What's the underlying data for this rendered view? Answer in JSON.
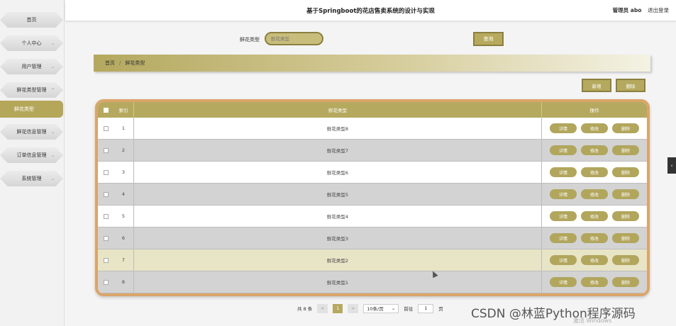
{
  "app": {
    "title": "基于Springboot的花店售卖系统的设计与实现",
    "user": "管理员 abo",
    "logout": "退出登录"
  },
  "sidebar": {
    "items": [
      {
        "label": "首页",
        "chevron": ""
      },
      {
        "label": "个人中心",
        "chevron": "⌄"
      },
      {
        "label": "用户管理",
        "chevron": "⌄"
      },
      {
        "label": "鲜花类型管理",
        "chevron": "^"
      },
      {
        "label": "鲜花信息管理",
        "chevron": "⌄"
      },
      {
        "label": "订单信息管理",
        "chevron": "⌄"
      },
      {
        "label": "系统管理",
        "chevron": "⌄"
      }
    ],
    "active_sub": "鲜花类型"
  },
  "search": {
    "label": "鲜花类型",
    "placeholder": "鲜花类型",
    "button": "查询"
  },
  "breadcrumb": {
    "home": "首页",
    "sep": "/",
    "current": "鲜花类型"
  },
  "actions": {
    "add": "新增",
    "delete": "删除"
  },
  "table": {
    "headers": {
      "index": "索引",
      "type": "鲜花类型",
      "ops": "操作"
    },
    "rows": [
      {
        "index": "1",
        "type": "鲜花类型8"
      },
      {
        "index": "2",
        "type": "鲜花类型7"
      },
      {
        "index": "3",
        "type": "鲜花类型6"
      },
      {
        "index": "4",
        "type": "鲜花类型5"
      },
      {
        "index": "5",
        "type": "鲜花类型4"
      },
      {
        "index": "6",
        "type": "鲜花类型3"
      },
      {
        "index": "7",
        "type": "鲜花类型2"
      },
      {
        "index": "8",
        "type": "鲜花类型1"
      }
    ],
    "op_labels": {
      "detail": "详情",
      "edit": "修改",
      "delete": "删除"
    }
  },
  "pager": {
    "total": "共 8 条",
    "prev": "<",
    "page": "1",
    "next": ">",
    "page_size": "10条/页",
    "goto_label": "前往",
    "goto_value": "1",
    "goto_suffix": "页"
  },
  "side_tab": "‹",
  "watermark": "CSDN @林蓝Python程序源码",
  "windows_mark": "激活 Windows"
}
